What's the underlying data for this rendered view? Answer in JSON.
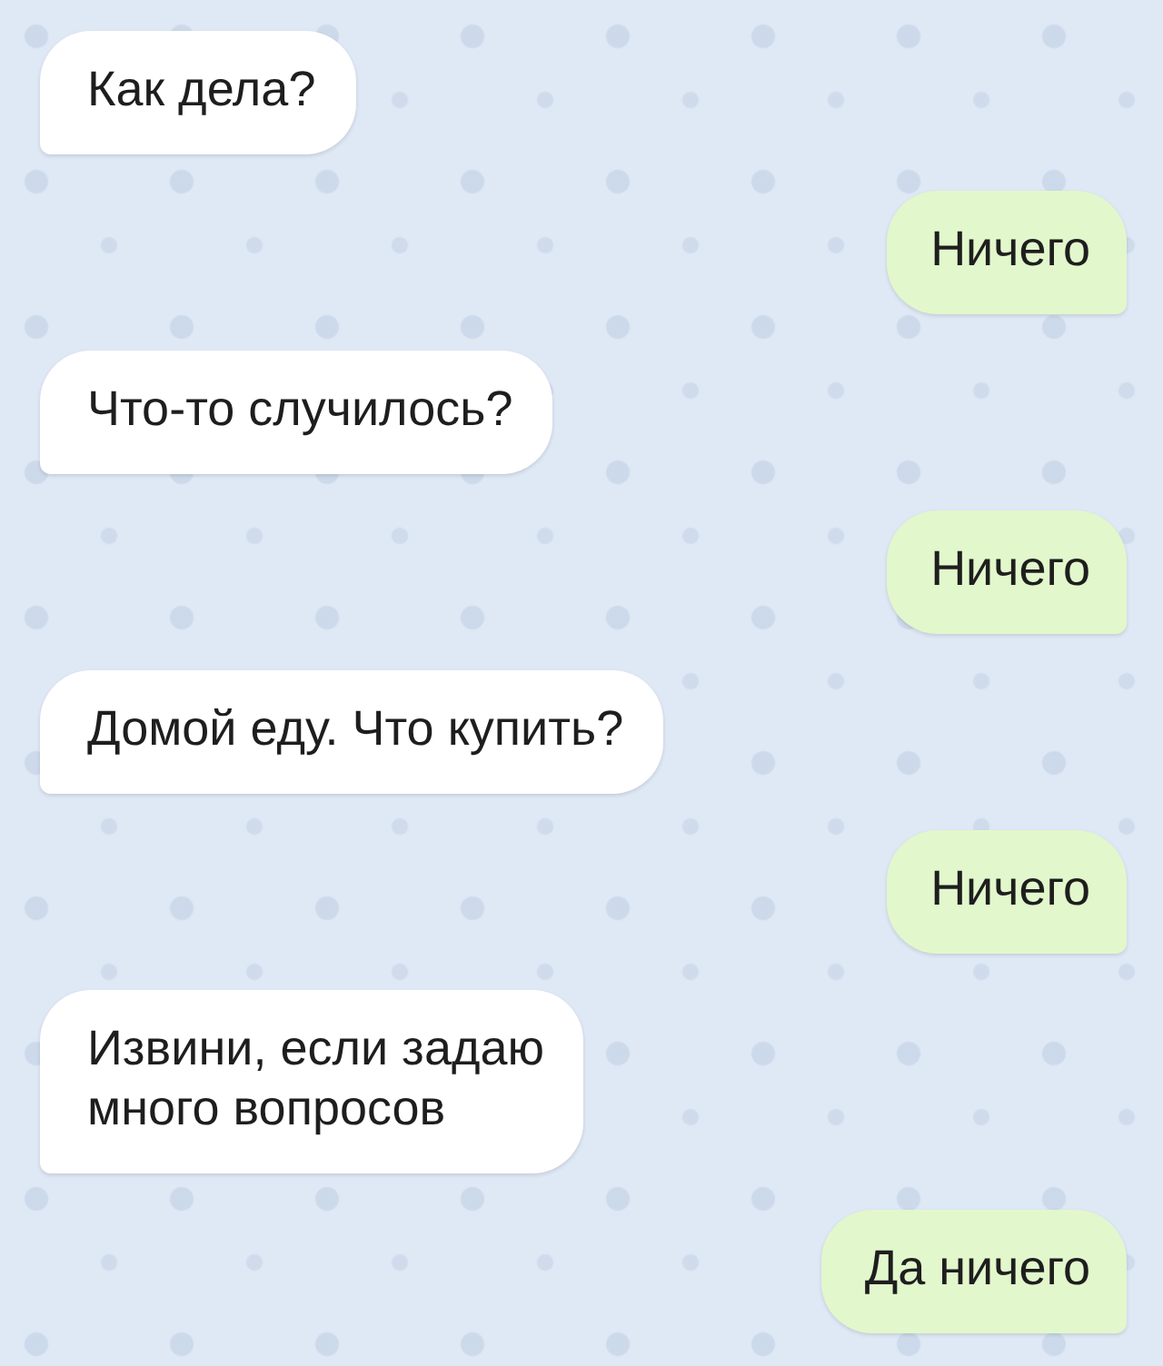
{
  "messages": [
    {
      "kind": "incoming",
      "lines": [
        "Как дела?"
      ]
    },
    {
      "kind": "outgoing",
      "lines": [
        "Ничего"
      ]
    },
    {
      "kind": "incoming",
      "lines": [
        "Что-то случилось?"
      ]
    },
    {
      "kind": "outgoing",
      "lines": [
        "Ничего"
      ]
    },
    {
      "kind": "incoming",
      "lines": [
        "Домой еду. Что купить?"
      ]
    },
    {
      "kind": "outgoing",
      "lines": [
        "Ничего"
      ]
    },
    {
      "kind": "incoming",
      "lines": [
        "Извини, если задаю",
        "много вопросов"
      ]
    },
    {
      "kind": "outgoing",
      "lines": [
        "Да ничего"
      ]
    }
  ]
}
